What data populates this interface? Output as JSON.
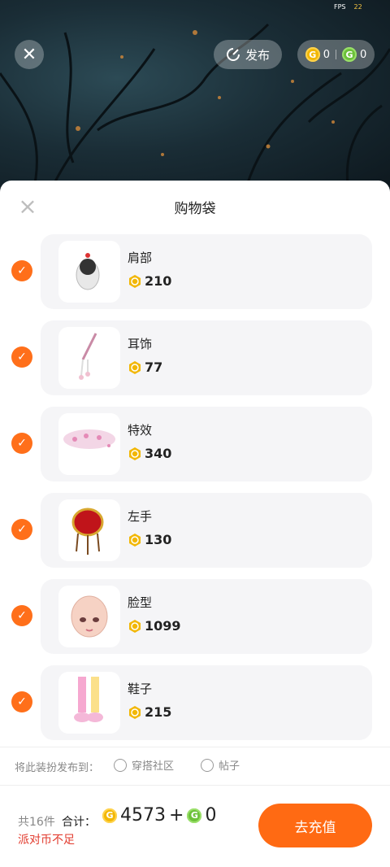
{
  "status": {
    "fps_label": "FPS",
    "fps_value": "22"
  },
  "top_bar": {
    "close_icon": "close-icon",
    "publish_label": "发布",
    "gold_balance": "0",
    "green_balance": "0"
  },
  "sheet": {
    "title": "购物袋"
  },
  "items": [
    {
      "name": "肩部",
      "price": "210",
      "checked": true,
      "icon": "shoulder-item-icon"
    },
    {
      "name": "耳饰",
      "price": "77",
      "checked": true,
      "icon": "earring-item-icon"
    },
    {
      "name": "特效",
      "price": "340",
      "checked": true,
      "icon": "effect-item-icon"
    },
    {
      "name": "左手",
      "price": "130",
      "checked": true,
      "icon": "left-hand-item-icon"
    },
    {
      "name": "脸型",
      "price": "1099",
      "checked": true,
      "icon": "face-item-icon"
    },
    {
      "name": "鞋子",
      "price": "215",
      "checked": true,
      "icon": "shoes-item-icon"
    }
  ],
  "publish": {
    "label": "将此装扮发布到：",
    "options": [
      "穿搭社区",
      "帖子"
    ]
  },
  "footer": {
    "count": "共16件",
    "total_label": "合计：",
    "gold_total": "4573",
    "plus": "+",
    "green_total": "0",
    "warning": "派对币不足",
    "recharge_label": "去充值"
  },
  "colors": {
    "accent": "#ff6a13",
    "check": "#ff6f1a",
    "gold_coin": "#f2b705",
    "green_coin": "#6cc13a",
    "warning": "#e23b2e"
  }
}
